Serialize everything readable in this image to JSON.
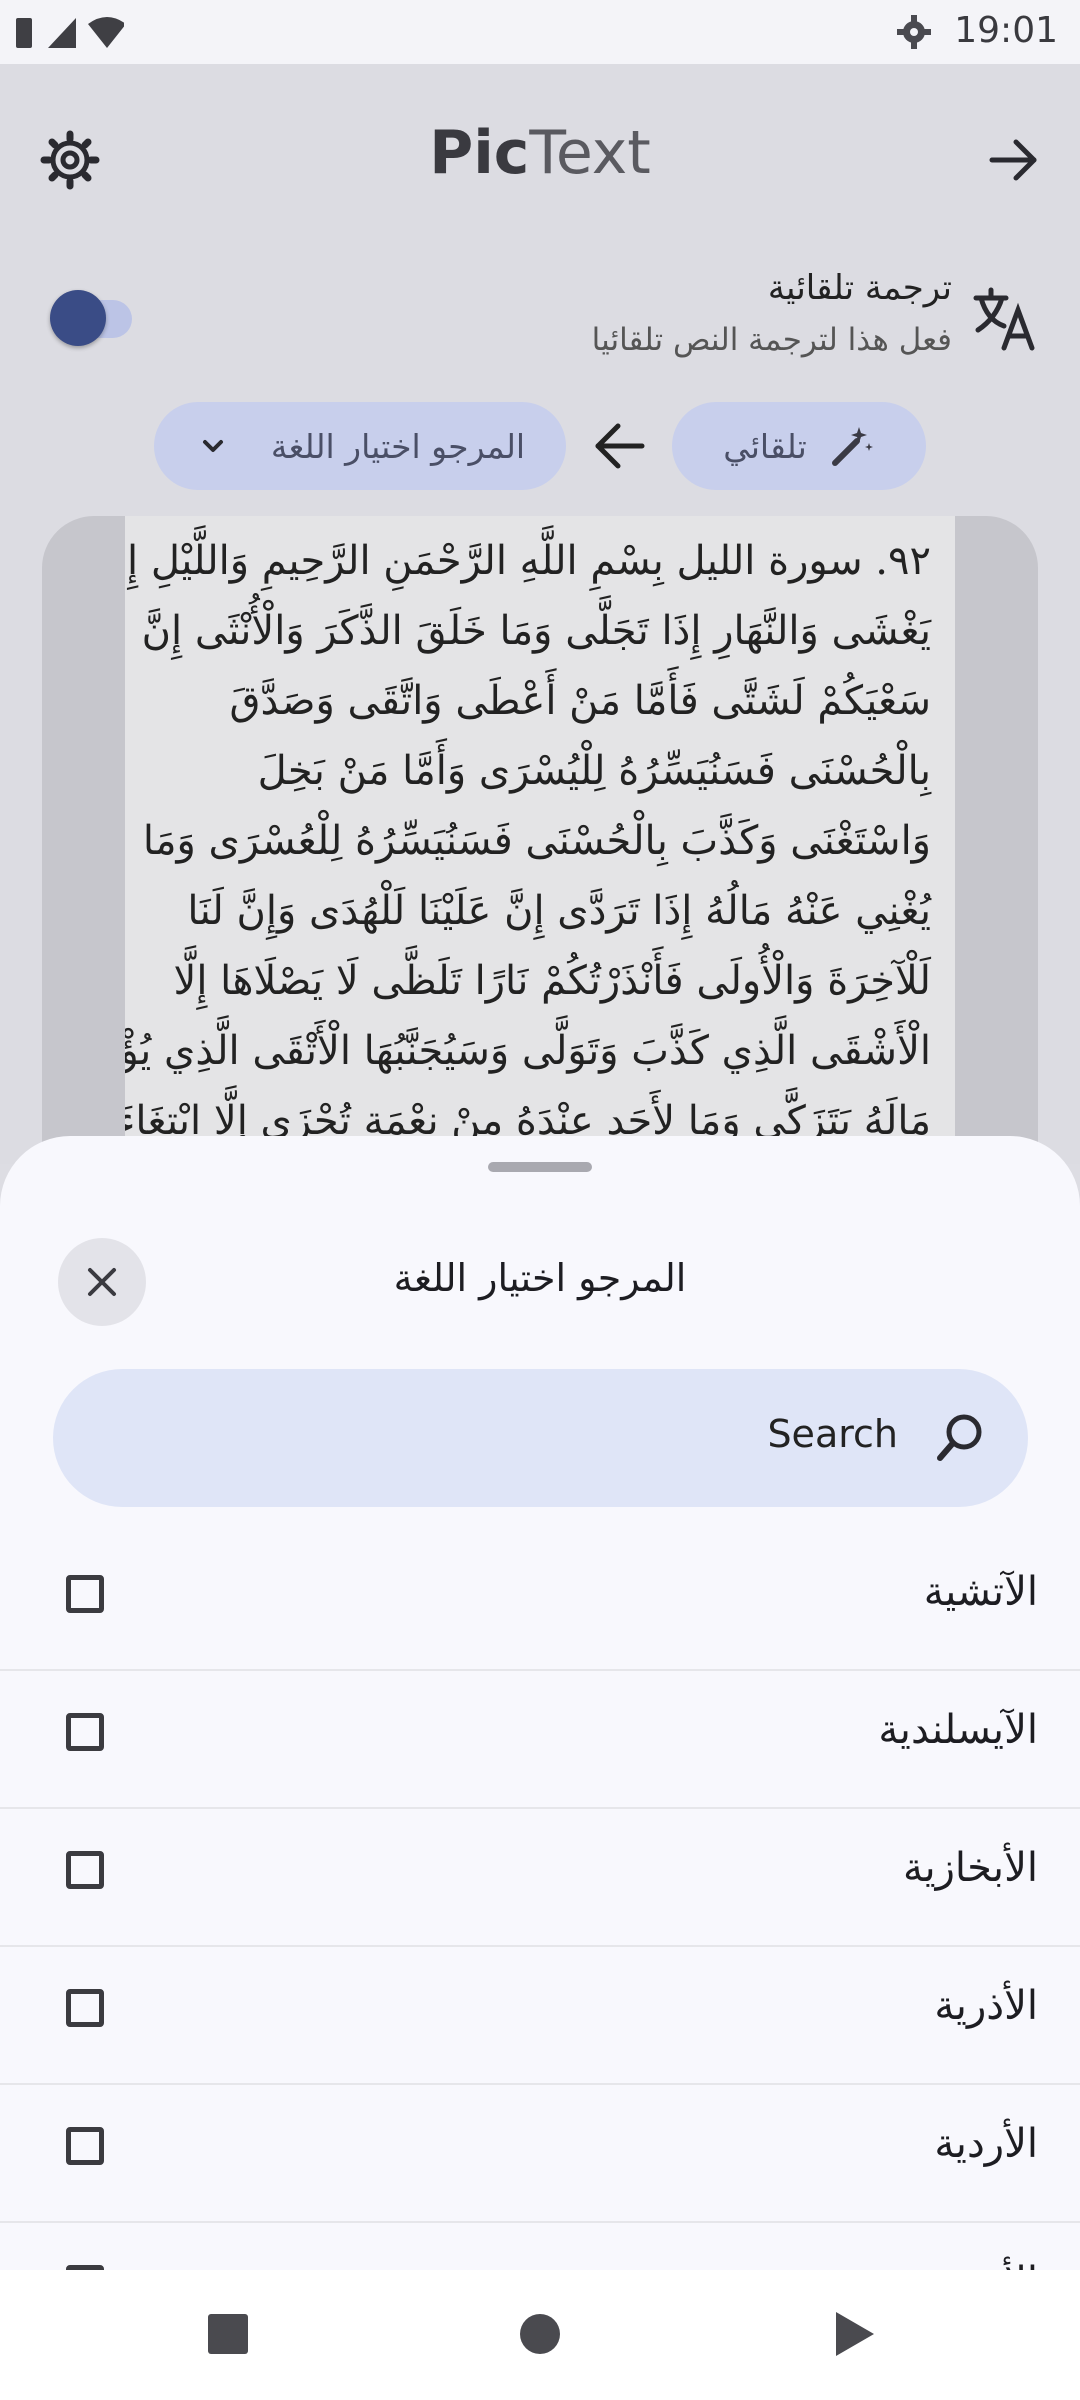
{
  "status_bar": {
    "time": "19:01"
  },
  "header": {
    "brand_bold": "Pic",
    "brand_light": "Text"
  },
  "auto_translate": {
    "title": "ترجمة تلقائية",
    "subtitle": "فعل هذا لترجمة النص تلقائيا",
    "enabled": false
  },
  "language_bar": {
    "source_label": "تلقائي",
    "target_label": "المرجو اختيار اللغة"
  },
  "scanned_text": {
    "lines": [
      "٩٢. سورة الليل بِسْمِ اللَّهِ الرَّحْمَنِ الرَّحِيمِ وَاللَّيْلِ إِذَا",
      "يَغْشَى وَالنَّهَارِ إِذَا تَجَلَّى وَمَا خَلَقَ الذَّكَرَ وَالْأُنْثَى إِنَّ",
      "سَعْيَكُمْ لَشَتَّى فَأَمَّا مَنْ أَعْطَى وَاتَّقَى وَصَدَّقَ",
      "بِالْحُسْنَى فَسَنُيَسِّرُهُ لِلْيُسْرَى وَأَمَّا مَنْ بَخِلَ",
      "وَاسْتَغْنَى وَكَذَّبَ بِالْحُسْنَى فَسَنُيَسِّرُهُ لِلْعُسْرَى وَمَا",
      "يُغْنِي عَنْهُ مَالُهُ إِذَا تَرَدَّى إِنَّ عَلَيْنَا لَلْهُدَى وَإِنَّ لَنَا",
      "لَلْآخِرَةَ وَالْأُولَى فَأَنْذَرْتُكُمْ نَارًا تَلَظَّى لَا يَصْلَاهَا إِلَّا",
      "الْأَشْقَى الَّذِي كَذَّبَ وَتَوَلَّى وَسَيُجَنَّبُهَا الْأَتْقَى الَّذِي يُؤْتِي",
      "مَالَهُ يَتَزَكَّى وَمَا لِأَحَدٍ عِنْدَهُ مِنْ نِعْمَةٍ تُجْزَى إِلَّا ابْتِغَاءَ"
    ]
  },
  "language_sheet": {
    "title": "المرجو اختيار اللغة",
    "search_placeholder": "Search",
    "languages": [
      {
        "label": "الآتشية",
        "checked": false
      },
      {
        "label": "الآيسلندية",
        "checked": false
      },
      {
        "label": "الأبخازية",
        "checked": false
      },
      {
        "label": "الأذرية",
        "checked": false
      },
      {
        "label": "الأردية",
        "checked": false
      },
      {
        "label": "الأرمنية",
        "checked": false
      }
    ]
  },
  "colors": {
    "accent": "#3a4c86",
    "pill_bg": "#c8cfec",
    "search_bg": "#dfe5f7",
    "sheet_bg": "#f8f8fd"
  }
}
